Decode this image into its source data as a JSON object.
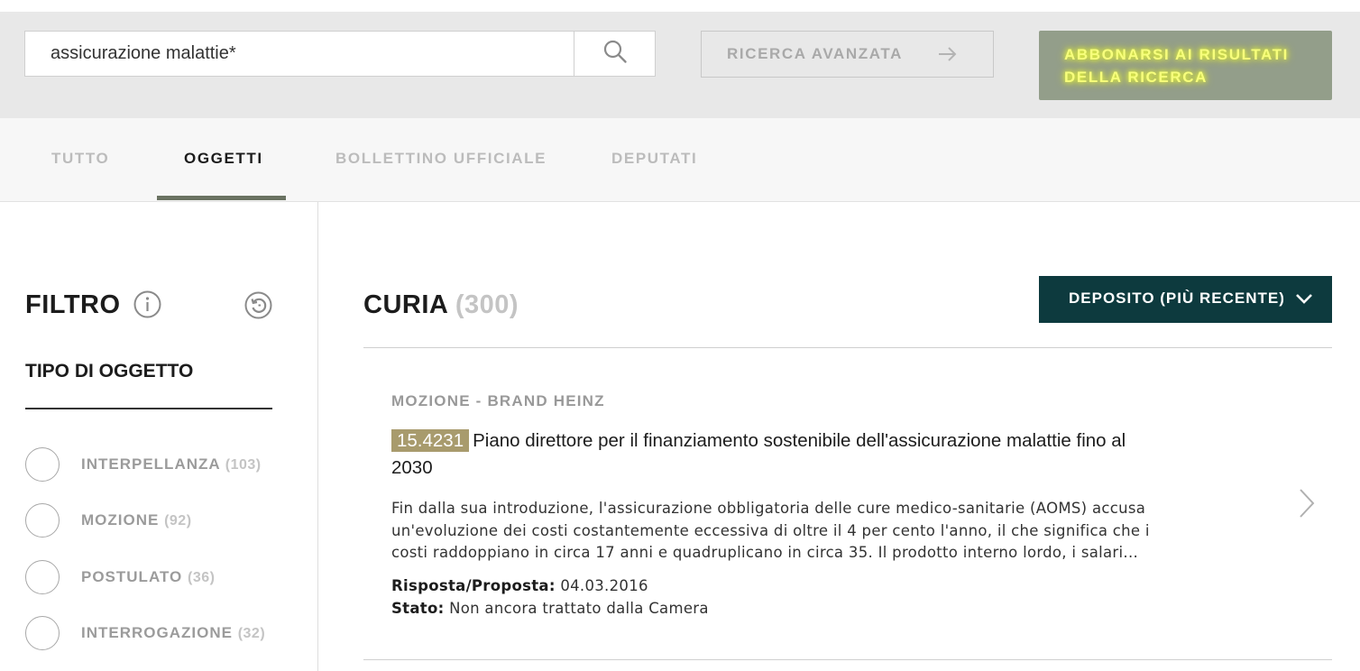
{
  "search": {
    "query": "assicurazione malattie*",
    "advanced_label": "RICERCA AVANZATA",
    "subscribe_line1": "ABBONARSI AI RISULTATI",
    "subscribe_line2": "DELLA RICERCA"
  },
  "tabs": [
    {
      "label": "TUTTO",
      "active": false
    },
    {
      "label": "OGGETTI",
      "active": true
    },
    {
      "label": "BOLLETTINO UFFICIALE",
      "active": false
    },
    {
      "label": "DEPUTATI",
      "active": false
    }
  ],
  "filter": {
    "title": "FILTRO",
    "section_title": "TIPO DI OGGETTO",
    "items": [
      {
        "label": "INTERPELLANZA",
        "count": "(103)"
      },
      {
        "label": "MOZIONE",
        "count": "(92)"
      },
      {
        "label": "POSTULATO",
        "count": "(36)"
      },
      {
        "label": "INTERROGAZIONE",
        "count": "(32)"
      }
    ]
  },
  "results": {
    "title": "CURIA",
    "count": "(300)",
    "sort_label": "DEPOSITO (PIÙ RECENTE)",
    "items": [
      {
        "type_line": "MOZIONE - BRAND HEINZ",
        "number": "15.4231",
        "title": "Piano direttore per il finanziamento sostenibile dell'assicurazione malattie fino al 2030",
        "abstract": "Fin dalla sua introduzione, l'assicurazione obbligatoria delle cure medico-sanitarie (AOMS) accusa un'evoluzione dei costi costantemente eccessiva di oltre il 4 per cento l'anno, il che significa che i costi raddoppiano in circa 17 anni e quadruplicano in circa 35. Il prodotto interno lordo, i salari...",
        "answer_label": "Risposta/Proposta:",
        "answer_value": "04.03.2016",
        "status_label": "Stato:",
        "status_value": "Non ancora trattato dalla Camera"
      }
    ]
  },
  "colors": {
    "accent_dark": "#0d3a3e",
    "subscribe_bg": "#939e8a",
    "highlight_text": "#f7ff7c",
    "number_badge": "#a89b6d",
    "tab_underline": "#6a7262"
  },
  "icons": {
    "search": "search-icon",
    "advanced_arrow": "arrow-right-icon",
    "info": "info-icon",
    "reset": "reset-icon",
    "sort_chevron": "chevron-down-icon",
    "result_chevron": "chevron-right-icon"
  }
}
